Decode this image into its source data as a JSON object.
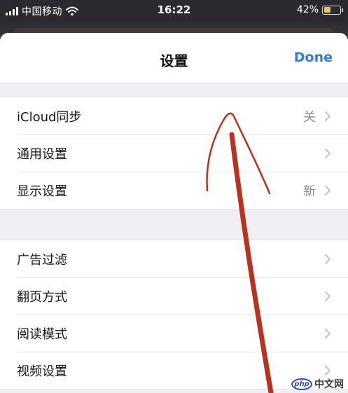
{
  "status_bar": {
    "carrier": "中国移动",
    "time": "16:22",
    "battery_percent": "42%",
    "battery_level": 0.42,
    "signal_icon": "cellular-signal-icon",
    "wifi_icon": "wifi-icon",
    "battery_icon": "battery-icon"
  },
  "header": {
    "title": "设置",
    "done_label": "Done"
  },
  "group1": {
    "items": [
      {
        "label": "iCloud同步",
        "value": "关"
      },
      {
        "label": "通用设置",
        "value": ""
      },
      {
        "label": "显示设置",
        "value": "新"
      }
    ]
  },
  "group2": {
    "items": [
      {
        "label": "广告过滤",
        "value": ""
      },
      {
        "label": "翻页方式",
        "value": ""
      },
      {
        "label": "阅读模式",
        "value": ""
      },
      {
        "label": "视频设置",
        "value": ""
      }
    ]
  },
  "watermark": {
    "badge": "php",
    "text": "中文网"
  },
  "colors": {
    "accent": "#2f7fd8",
    "annotation": "#b8321f",
    "battery": "#f2c744"
  }
}
